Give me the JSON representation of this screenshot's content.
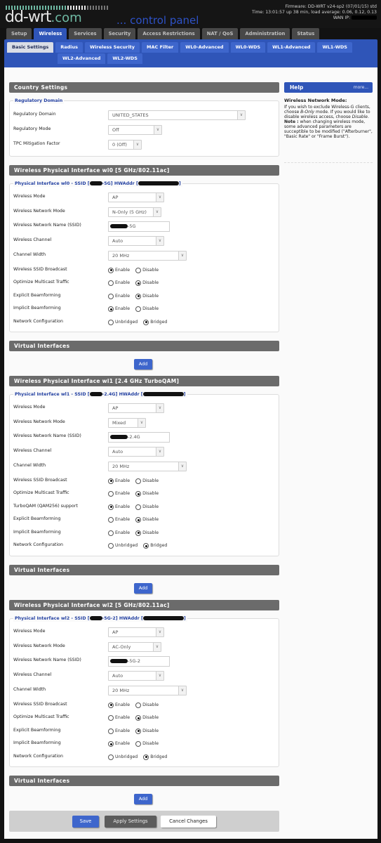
{
  "header": {
    "logo_main": "dd-wrt",
    "logo_com": ".com",
    "logo_sub": "... control panel",
    "firmware": "Firmware: DD-WRT v24-sp2 (07/01/15) std",
    "time": "Time: 13:01:57 up 38 min, load average: 0.06, 0.12, 0.13",
    "wan_ip_label": "WAN IP:"
  },
  "main_tabs": [
    {
      "label": "Setup",
      "active": false
    },
    {
      "label": "Wireless",
      "active": true
    },
    {
      "label": "Services",
      "active": false
    },
    {
      "label": "Security",
      "active": false
    },
    {
      "label": "Access Restrictions",
      "active": false
    },
    {
      "label": "NAT / QoS",
      "active": false
    },
    {
      "label": "Administration",
      "active": false
    },
    {
      "label": "Status",
      "active": false
    }
  ],
  "sub_tabs": [
    {
      "label": "Basic Settings",
      "active": true
    },
    {
      "label": "Radius",
      "active": false
    },
    {
      "label": "Wireless Security",
      "active": false
    },
    {
      "label": "MAC Filter",
      "active": false
    },
    {
      "label": "WL0-Advanced",
      "active": false
    },
    {
      "label": "WL0-WDS",
      "active": false
    },
    {
      "label": "WL1-Advanced",
      "active": false
    },
    {
      "label": "WL1-WDS",
      "active": false
    },
    {
      "label": "WL2-Advanced",
      "active": false
    },
    {
      "label": "WL2-WDS",
      "active": false
    }
  ],
  "country": {
    "title": "Country Settings",
    "legend": "Regulatory Domain",
    "fields": [
      {
        "label": "Regulatory Domain",
        "value": "UNITED_STATES"
      },
      {
        "label": "Regulatory Mode",
        "value": "Off"
      },
      {
        "label": "TPC Mitigation Factor",
        "value": "0 (Off)"
      }
    ]
  },
  "interfaces": [
    {
      "title": "Wireless Physical Interface wl0 [5 GHz/802.11ac]",
      "legend_prefix": "Physical Interface wl0 - SSID [",
      "legend_ssid_suffix": "-5G] HWAddr [",
      "legend_end": "]",
      "wireless_mode_label": "Wireless Mode",
      "wireless_mode": "AP",
      "network_mode_label": "Wireless Network Mode",
      "network_mode": "N-Only (5 GHz)",
      "ssid_label": "Wireless Network Name (SSID)",
      "ssid_suffix": "-5G",
      "channel_label": "Wireless Channel",
      "channel": "Auto",
      "width_label": "Channel Width",
      "width": "20 MHz",
      "radios": [
        {
          "label": "Wireless SSID Broadcast",
          "options": [
            "Enable",
            "Disable"
          ],
          "selected": 0
        },
        {
          "label": "Optimize Multicast Traffic",
          "options": [
            "Enable",
            "Disable"
          ],
          "selected": 1
        },
        {
          "label": "Explicit Beamforming",
          "options": [
            "Enable",
            "Disable"
          ],
          "selected": 1
        },
        {
          "label": "Implicit Beamforming",
          "options": [
            "Enable",
            "Disable"
          ],
          "selected": 0
        },
        {
          "label": "Network Configuration",
          "options": [
            "Unbridged",
            "Bridged"
          ],
          "selected": 1
        }
      ]
    },
    {
      "title": "Wireless Physical Interface wl1 [2.4 GHz TurboQAM]",
      "legend_prefix": "Physical Interface wl1 - SSID [",
      "legend_ssid_suffix": "-2.4G] HWAddr [",
      "legend_end": "]",
      "wireless_mode_label": "Wireless Mode",
      "wireless_mode": "AP",
      "network_mode_label": "Wireless Network Mode",
      "network_mode": "Mixed",
      "ssid_label": "Wireless Network Name (SSID)",
      "ssid_suffix": "-2.4G",
      "channel_label": "Wireless Channel",
      "channel": "Auto",
      "width_label": "Channel Width",
      "width": "20 MHz",
      "radios": [
        {
          "label": "Wireless SSID Broadcast",
          "options": [
            "Enable",
            "Disable"
          ],
          "selected": 0
        },
        {
          "label": "Optimize Multicast Traffic",
          "options": [
            "Enable",
            "Disable"
          ],
          "selected": 1
        },
        {
          "label": "TurboQAM (QAM256) support",
          "options": [
            "Enable",
            "Disable"
          ],
          "selected": 0
        },
        {
          "label": "Explicit Beamforming",
          "options": [
            "Enable",
            "Disable"
          ],
          "selected": 1
        },
        {
          "label": "Implicit Beamforming",
          "options": [
            "Enable",
            "Disable"
          ],
          "selected": 1
        },
        {
          "label": "Network Configuration",
          "options": [
            "Unbridged",
            "Bridged"
          ],
          "selected": 1
        }
      ]
    },
    {
      "title": "Wireless Physical Interface wl2 [5 GHz/802.11ac]",
      "legend_prefix": "Physical Interface wl2 - SSID [",
      "legend_ssid_suffix": "-5G-2] HWAddr [",
      "legend_end": "]",
      "wireless_mode_label": "Wireless Mode",
      "wireless_mode": "AP",
      "network_mode_label": "Wireless Network Mode",
      "network_mode": "AC-Only",
      "ssid_label": "Wireless Network Name (SSID)",
      "ssid_suffix": "-5G-2",
      "channel_label": "Wireless Channel",
      "channel": "Auto",
      "width_label": "Channel Width",
      "width": "20 MHz",
      "radios": [
        {
          "label": "Wireless SSID Broadcast",
          "options": [
            "Enable",
            "Disable"
          ],
          "selected": 0
        },
        {
          "label": "Optimize Multicast Traffic",
          "options": [
            "Enable",
            "Disable"
          ],
          "selected": 1
        },
        {
          "label": "Explicit Beamforming",
          "options": [
            "Enable",
            "Disable"
          ],
          "selected": 1
        },
        {
          "label": "Implicit Beamforming",
          "options": [
            "Enable",
            "Disable"
          ],
          "selected": 0
        },
        {
          "label": "Network Configuration",
          "options": [
            "Unbridged",
            "Bridged"
          ],
          "selected": 1
        }
      ]
    }
  ],
  "virtual": {
    "title": "Virtual Interfaces",
    "add_label": "Add"
  },
  "help": {
    "title": "Help",
    "more": "more...",
    "heading": "Wireless Network Mode:",
    "p1a": "If you wish to exclude Wireless-G clients, choose ",
    "p1b": "B-Only",
    "p1c": " mode. If you would like to disable wireless access, choose ",
    "p1d": "Disable",
    "p1e": ".",
    "note_label": "Note :",
    "note_text": " when changing wireless mode, some advanced parameters are succeptible to be modified (\"Afterburner\", \"Basic Rate\" or \"Frame Burst\")."
  },
  "footer": {
    "save": "Save",
    "apply": "Apply Settings",
    "cancel": "Cancel Changes"
  }
}
